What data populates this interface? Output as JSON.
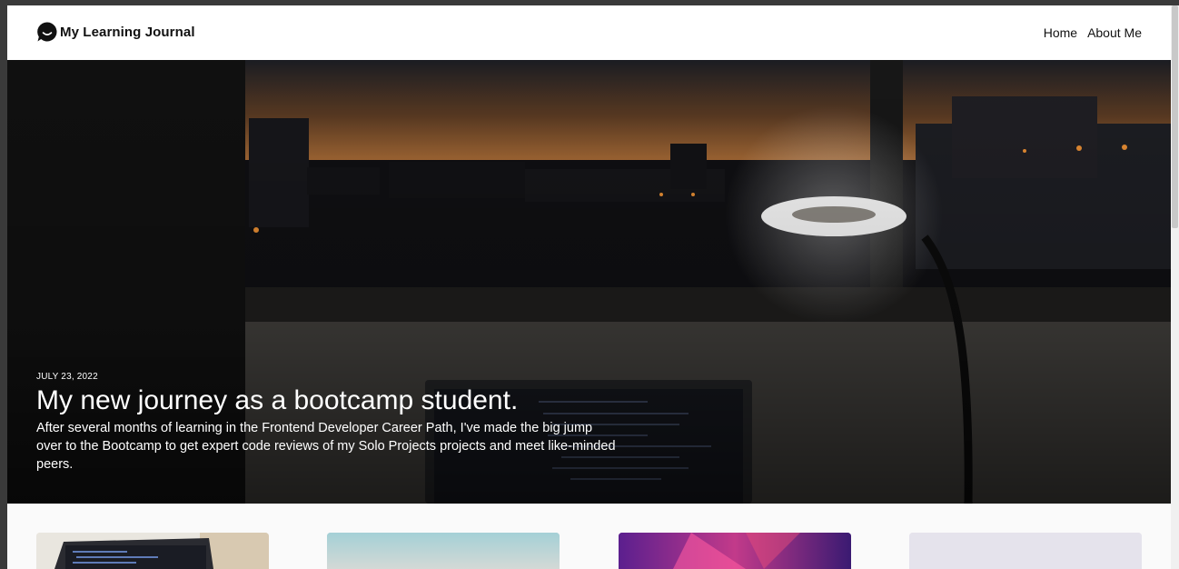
{
  "brand": {
    "title": "My Learning Journal",
    "logo_icon": "chat-bubble-icon"
  },
  "nav": {
    "items": [
      {
        "label": "Home"
      },
      {
        "label": "About Me"
      }
    ]
  },
  "hero": {
    "date": "JULY 23, 2022",
    "title": "My new journey as a bootcamp student.",
    "description": "After several months of learning in the Frontend Developer Career Path, I've made the big jump over to the Bootcamp to get expert code reviews of my Solo Projects projects and meet like-minded peers."
  },
  "cards": [
    {
      "thumbnail": "laptop-code-image"
    },
    {
      "thumbnail": "sky-landscape-image"
    },
    {
      "thumbnail": "purple-abstract-image"
    },
    {
      "thumbnail": "lavender-image"
    }
  ],
  "colors": {
    "header_bg": "#ffffff",
    "text": "#111111",
    "hero_text": "#ffffff",
    "page_bg": "#fafafa"
  }
}
